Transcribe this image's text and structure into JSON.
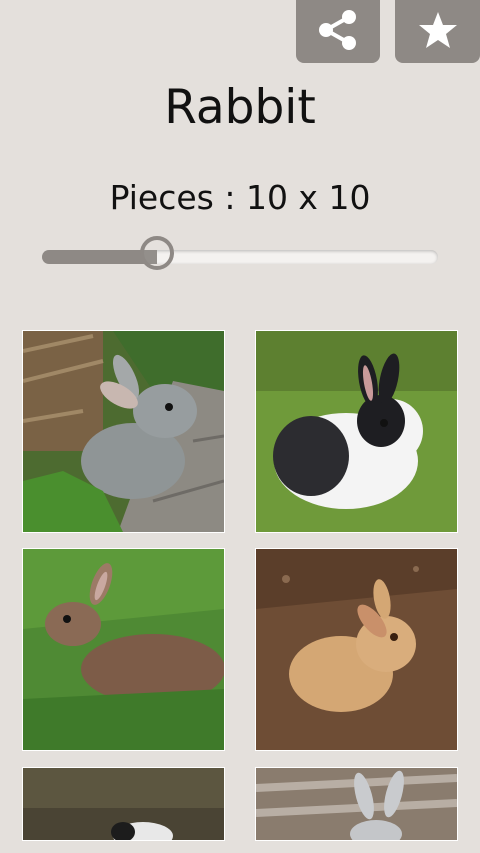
{
  "header": {
    "share_icon": "share-icon",
    "star_icon": "star-icon"
  },
  "title": "Rabbit",
  "pieces": {
    "label": "Pieces : 10 x 10",
    "slider_fraction": 0.29
  },
  "gallery": {
    "images": [
      {
        "name": "gray-rabbit-by-log"
      },
      {
        "name": "black-white-rabbit-on-grass"
      },
      {
        "name": "brown-wild-rabbit-on-grass"
      },
      {
        "name": "tan-rabbit-on-dirt"
      },
      {
        "name": "partial-rabbit-bottom-left"
      },
      {
        "name": "partial-rabbit-bottom-right"
      }
    ]
  }
}
